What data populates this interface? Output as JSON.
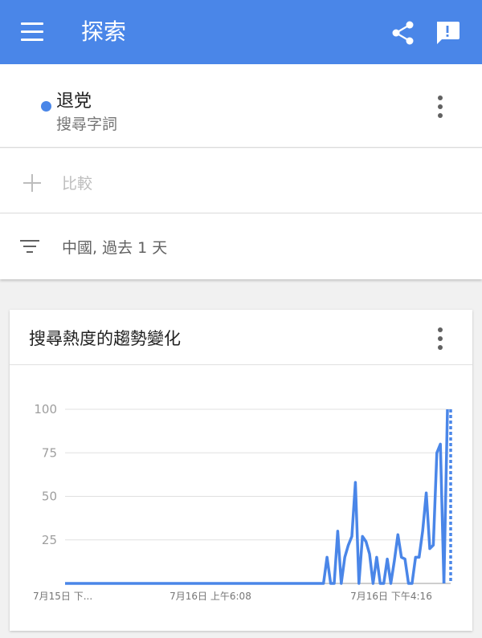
{
  "appbar": {
    "title": "探索",
    "menu_icon": "menu-icon",
    "share_icon": "share-icon",
    "feedback_icon": "feedback-icon",
    "color": "#4a86e8"
  },
  "term": {
    "name": "退党",
    "type": "搜尋字詞",
    "dot_color": "#4a86e8"
  },
  "compare": {
    "label": "比較"
  },
  "filter": {
    "label": "中國, 過去 1 天"
  },
  "interest_card": {
    "title": "搜尋熱度的趨勢變化"
  },
  "chart_data": {
    "type": "line",
    "title": "",
    "xlabel": "",
    "ylabel": "",
    "ylim": [
      0,
      100
    ],
    "yticks": [
      25,
      50,
      75,
      100
    ],
    "xtick_labels": [
      "7月15日 下...",
      "7月16日 上午6:08",
      "7月16日 下午4:16"
    ],
    "grid": true,
    "series": [
      {
        "color": "#4a86e8",
        "values": [
          0,
          0,
          0,
          0,
          0,
          0,
          0,
          0,
          0,
          0,
          0,
          0,
          0,
          0,
          0,
          0,
          0,
          0,
          0,
          0,
          0,
          0,
          0,
          0,
          0,
          0,
          0,
          0,
          0,
          0,
          0,
          0,
          0,
          0,
          0,
          0,
          0,
          0,
          0,
          0,
          0,
          0,
          0,
          0,
          0,
          0,
          0,
          0,
          0,
          0,
          0,
          0,
          0,
          0,
          0,
          0,
          0,
          0,
          0,
          0,
          0,
          0,
          0,
          0,
          0,
          0,
          0,
          0,
          0,
          0,
          0,
          0,
          0,
          0,
          15,
          0,
          0,
          30,
          0,
          15,
          22,
          27,
          58,
          0,
          27,
          24,
          17,
          0,
          15,
          0,
          0,
          14,
          0,
          13,
          28,
          15,
          14,
          0,
          0,
          15,
          15,
          30,
          52,
          20,
          22,
          75,
          80,
          0,
          100
        ],
        "partial_last": true
      }
    ]
  }
}
